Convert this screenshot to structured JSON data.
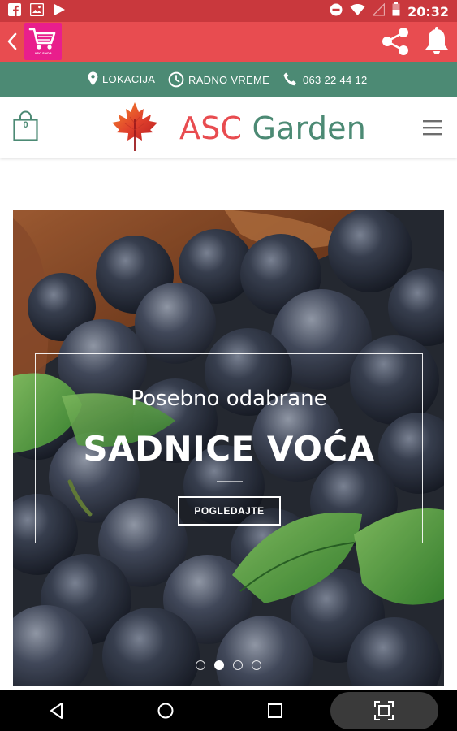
{
  "status_bar": {
    "time": "20:32",
    "icons_left": [
      "facebook-icon",
      "image-icon",
      "play-icon"
    ],
    "icons_right": [
      "dnd-icon",
      "wifi-icon",
      "signal-icon",
      "battery-icon"
    ]
  },
  "app_bar": {
    "logo_text": "ASC SHOP",
    "colors": {
      "background": "#e84c50",
      "logo_bg": "#e91e8c"
    }
  },
  "info_bar": {
    "location_label": "LOKACIJA",
    "hours_label": "RADNO VREME",
    "phone": "063 22 44 12",
    "colors": {
      "background": "#4c8a74"
    }
  },
  "header": {
    "cart_count": "0",
    "brand_part1": "ASC",
    "brand_part2": "Garden",
    "colors": {
      "red": "#e84c50",
      "green": "#4c8a74"
    }
  },
  "hero": {
    "subtitle": "Posebno odabrane",
    "title": "SADNICE VOĆA",
    "button_label": "POGLEDAJTE",
    "slides_total": 4,
    "active_slide": 2
  }
}
